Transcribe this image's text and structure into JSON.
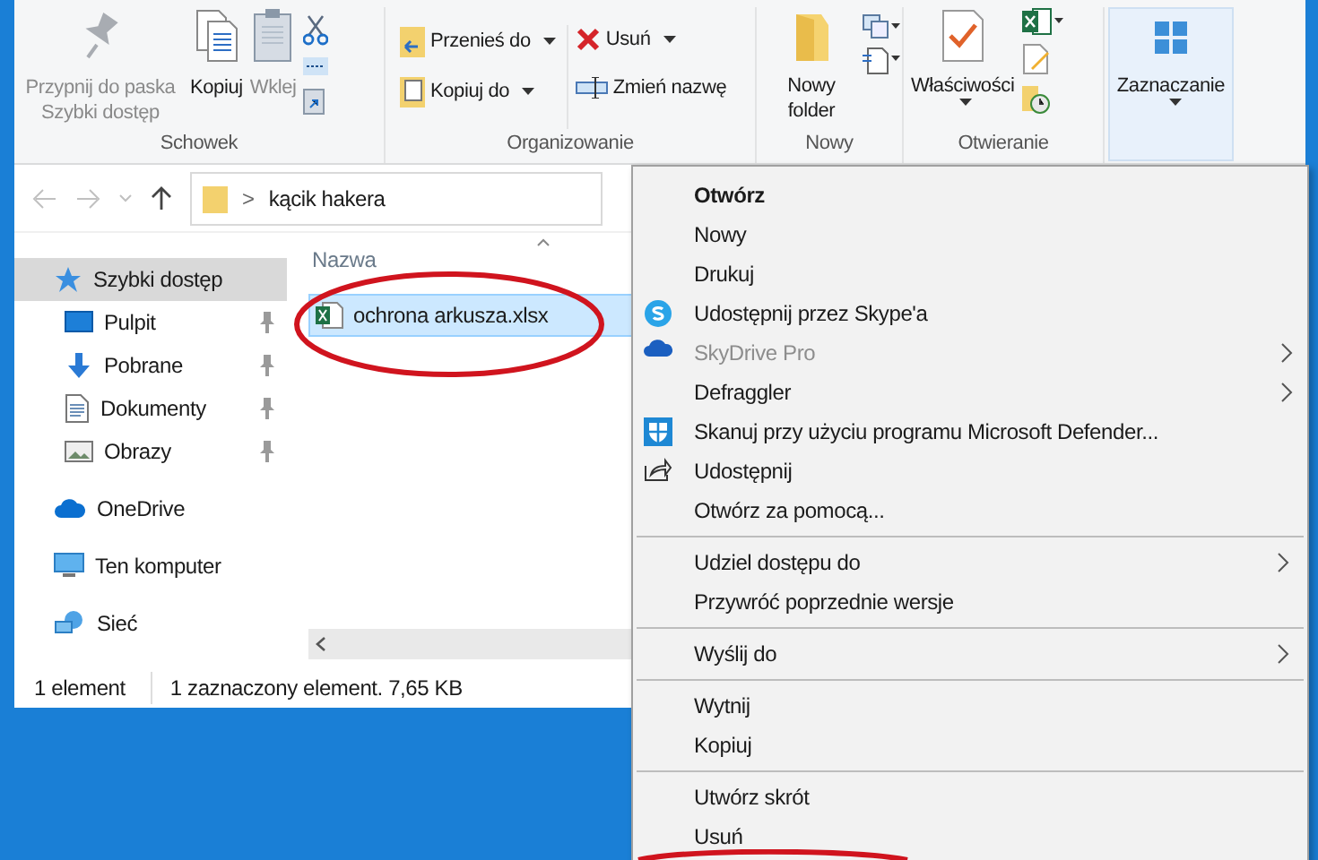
{
  "ribbon": {
    "groups": [
      {
        "label": "Schowek",
        "buttons": [
          {
            "label": "Przypnij do paska Szybki dostęp",
            "disabled": true
          },
          {
            "label": "Kopiuj",
            "disabled": false
          },
          {
            "label": "Wklej",
            "disabled": true
          }
        ]
      },
      {
        "label": "Organizowanie",
        "buttons": [
          {
            "label": "Przenieś do",
            "dropdown": true
          },
          {
            "label": "Kopiuj do",
            "dropdown": true
          },
          {
            "label": "Usuń",
            "dropdown": true
          },
          {
            "label": "Zmień nazwę",
            "dropdown": false
          }
        ]
      },
      {
        "label": "Nowy",
        "buttons": [
          {
            "label": "Nowy folder"
          }
        ]
      },
      {
        "label": "Otwieranie",
        "buttons": [
          {
            "label": "Właściwości",
            "dropdown": true
          }
        ]
      },
      {
        "buttons": [
          {
            "label": "Zaznaczanie",
            "dropdown": true,
            "selected": true
          }
        ]
      }
    ]
  },
  "address_bar": {
    "separator": ">",
    "path": "kącik hakera"
  },
  "navigation": [
    {
      "label": "Szybki dostęp",
      "selected": true,
      "children": [
        {
          "label": "Pulpit",
          "pinned": true
        },
        {
          "label": "Pobrane",
          "pinned": true
        },
        {
          "label": "Dokumenty",
          "pinned": true
        },
        {
          "label": "Obrazy",
          "pinned": true
        }
      ]
    },
    {
      "label": "OneDrive",
      "selected": false
    },
    {
      "label": "Ten komputer",
      "selected": false
    },
    {
      "label": "Sieć",
      "selected": false
    }
  ],
  "file_list": {
    "column": "Nazwa",
    "files": [
      {
        "name": "ochrona arkusza.xlsx",
        "selected": true
      }
    ]
  },
  "status_bar": {
    "count": "1 element",
    "selection": "1 zaznaczony element. 7,65 KB"
  },
  "context_menu": {
    "groups": [
      [
        {
          "label": "Otwórz",
          "bold": true
        },
        {
          "label": "Nowy"
        },
        {
          "label": "Drukuj"
        },
        {
          "label": "Udostępnij przez Skype'a"
        },
        {
          "label": "SkyDrive Pro",
          "disabled": true,
          "submenu": true
        },
        {
          "label": "Defraggler",
          "submenu": true
        },
        {
          "label": "Skanuj przy użyciu programu Microsoft Defender..."
        },
        {
          "label": "Udostępnij"
        },
        {
          "label": "Otwórz za pomocą..."
        }
      ],
      [
        {
          "label": "Udziel dostępu do",
          "submenu": true
        },
        {
          "label": "Przywróć poprzednie wersje"
        }
      ],
      [
        {
          "label": "Wyślij do",
          "submenu": true
        }
      ],
      [
        {
          "label": "Wytnij"
        },
        {
          "label": "Kopiuj"
        }
      ],
      [
        {
          "label": "Utwórz skrót"
        },
        {
          "label": "Usuń"
        }
      ]
    ]
  }
}
